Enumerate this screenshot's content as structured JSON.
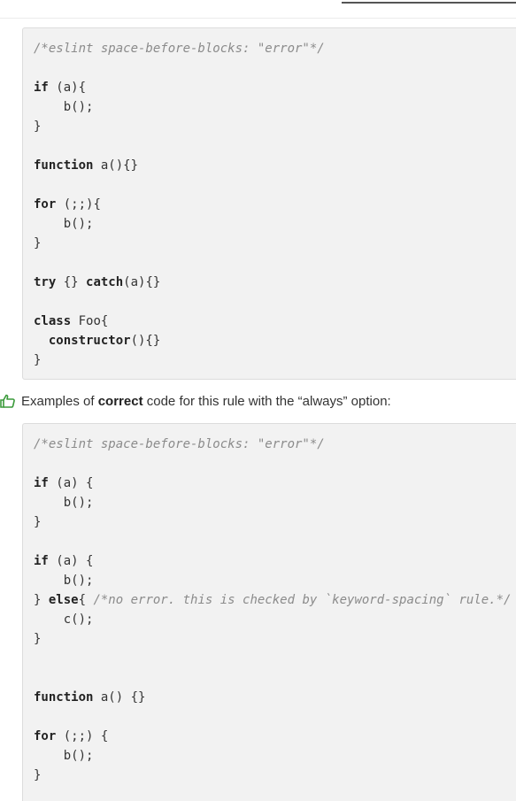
{
  "incorrect_block": {
    "lines": [
      [
        {
          "t": "/*eslint space-before-blocks: \"error\"*/",
          "k": "comment"
        }
      ],
      [],
      [
        {
          "t": "if",
          "k": "keyword"
        },
        {
          "t": " (a){",
          "k": "plain"
        }
      ],
      [
        {
          "t": "    b();",
          "k": "plain"
        }
      ],
      [
        {
          "t": "}",
          "k": "plain"
        }
      ],
      [],
      [
        {
          "t": "function",
          "k": "keyword"
        },
        {
          "t": " a(){}",
          "k": "plain"
        }
      ],
      [],
      [
        {
          "t": "for",
          "k": "keyword"
        },
        {
          "t": " (;;){",
          "k": "plain"
        }
      ],
      [
        {
          "t": "    b();",
          "k": "plain"
        }
      ],
      [
        {
          "t": "}",
          "k": "plain"
        }
      ],
      [],
      [
        {
          "t": "try",
          "k": "keyword"
        },
        {
          "t": " {} ",
          "k": "plain"
        },
        {
          "t": "catch",
          "k": "keyword"
        },
        {
          "t": "(a){}",
          "k": "plain"
        }
      ],
      [],
      [
        {
          "t": "class",
          "k": "keyword"
        },
        {
          "t": " Foo{",
          "k": "plain"
        }
      ],
      [
        {
          "t": "  ",
          "k": "plain"
        },
        {
          "t": "constructor",
          "k": "keyword"
        },
        {
          "t": "(){}",
          "k": "plain"
        }
      ],
      [
        {
          "t": "}",
          "k": "plain"
        }
      ]
    ]
  },
  "note": {
    "icon": "thumbs-up-icon",
    "icon_color": "#3a9a3a",
    "prefix": "Examples of ",
    "emphasis": "correct",
    "suffix": " code for this rule with the “always” option:"
  },
  "correct_block": {
    "lines": [
      [
        {
          "t": "/*eslint space-before-blocks: \"error\"*/",
          "k": "comment"
        }
      ],
      [],
      [
        {
          "t": "if",
          "k": "keyword"
        },
        {
          "t": " (a) {",
          "k": "plain"
        }
      ],
      [
        {
          "t": "    b();",
          "k": "plain"
        }
      ],
      [
        {
          "t": "}",
          "k": "plain"
        }
      ],
      [],
      [
        {
          "t": "if",
          "k": "keyword"
        },
        {
          "t": " (a) {",
          "k": "plain"
        }
      ],
      [
        {
          "t": "    b();",
          "k": "plain"
        }
      ],
      [
        {
          "t": "} ",
          "k": "plain"
        },
        {
          "t": "else",
          "k": "keyword"
        },
        {
          "t": "{ ",
          "k": "plain"
        },
        {
          "t": "/*no error. this is checked by `keyword-spacing` rule.*/",
          "k": "comment"
        }
      ],
      [
        {
          "t": "    c();",
          "k": "plain"
        }
      ],
      [
        {
          "t": "}",
          "k": "plain"
        }
      ],
      [],
      [],
      [
        {
          "t": "function",
          "k": "keyword"
        },
        {
          "t": " a() {}",
          "k": "plain"
        }
      ],
      [],
      [
        {
          "t": "for",
          "k": "keyword"
        },
        {
          "t": " (;;) {",
          "k": "plain"
        }
      ],
      [
        {
          "t": "    b();",
          "k": "plain"
        }
      ],
      [
        {
          "t": "}",
          "k": "plain"
        }
      ]
    ]
  }
}
